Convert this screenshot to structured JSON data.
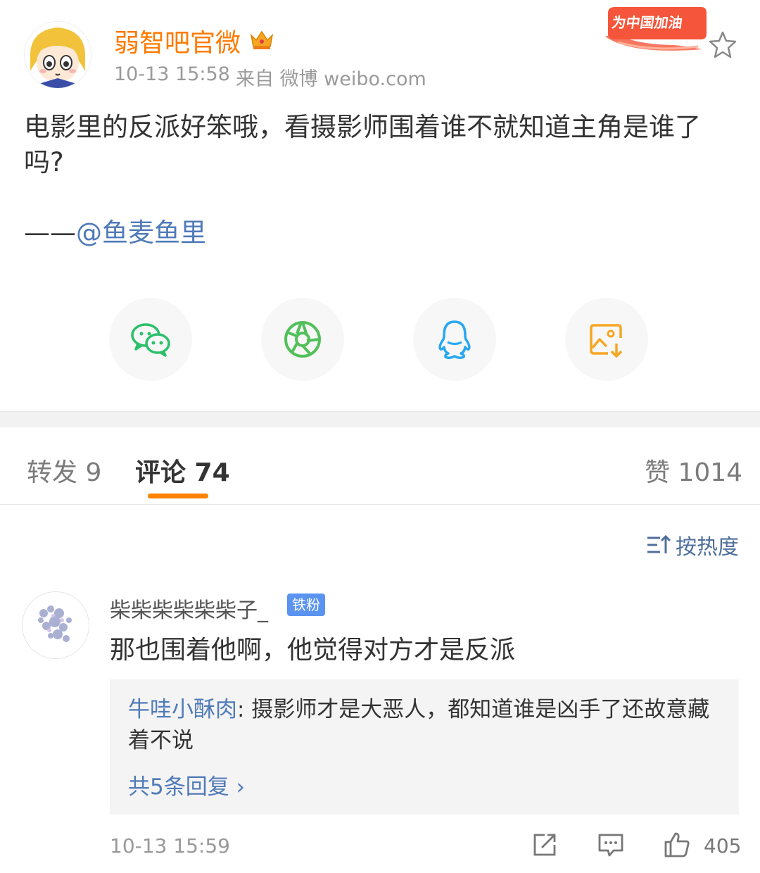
{
  "post": {
    "author": "弱智吧官微",
    "time": "10-13 15:58",
    "source": "来自 微博 weibo.com",
    "badge_text": "为中国加油",
    "text": "电影里的反派好笨哦，看摄影师围着谁不就知道主角是谁了吗?",
    "sign_prefix": "——",
    "mention": "@鱼麦鱼里"
  },
  "share": {
    "items": [
      "wechat-icon",
      "moments-icon",
      "qq-icon",
      "save-image-icon"
    ],
    "colors": {
      "wechat": "#2bbf6a",
      "moments": "#52c05a",
      "qq": "#28a7f0",
      "save": "#f5a623"
    }
  },
  "tabs": {
    "repost": "转发 9",
    "comments": "评论 74",
    "likes": "赞 1014"
  },
  "sort_label": "按热度",
  "comment": {
    "user": "柴柴柴柴柴柴子_",
    "badge": "铁粉",
    "text": "那也围着他啊，他觉得对方才是反派",
    "reply_user": "牛哇小酥肉",
    "reply_text": ": 摄影师才是大恶人，都知道谁是凶手了还故意藏着不说",
    "reply_more": "共5条回复 ›",
    "time": "10-13 15:59",
    "likes": "405"
  },
  "accent": "#ff8200"
}
